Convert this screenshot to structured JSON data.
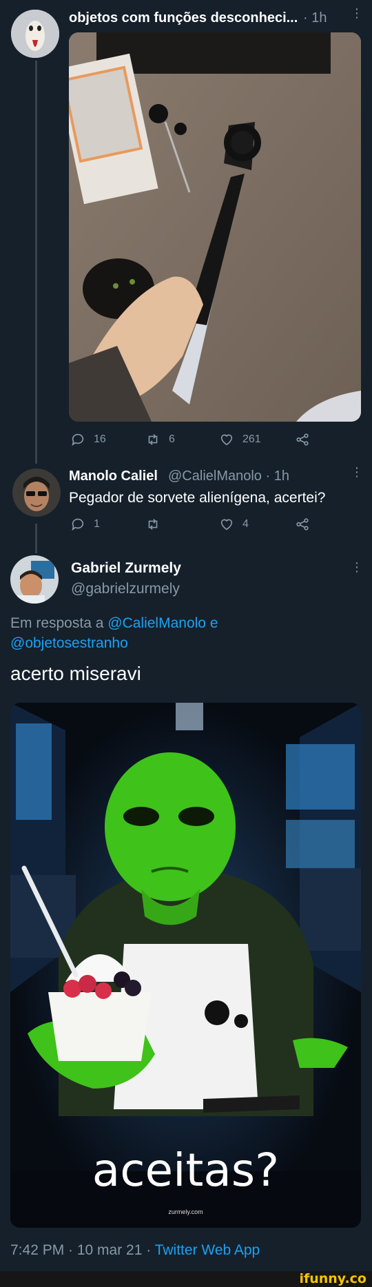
{
  "tweet1": {
    "author": "objetos com funções desconheci...",
    "time": "1h",
    "actions": {
      "reply": "16",
      "retweet": "6",
      "like": "261"
    }
  },
  "tweet2": {
    "name": "Manolo Caliel",
    "handle_time": "@CalielManolo · 1h",
    "text": "Pegador de sorvete alienígena, acertei?",
    "actions": {
      "reply": "1",
      "retweet": "",
      "like": "4"
    }
  },
  "tweet3": {
    "name": "Gabriel Zurmely",
    "handle": "@gabrielzurmely",
    "reply_prefix": "Em resposta a",
    "reply_mention1": "@CalielManolo",
    "reply_and": "e",
    "reply_mention2": "@objetosestranho",
    "text": "acerto miseravi",
    "meme_caption": "aceitas?",
    "meme_watermark": "zurmely.com",
    "footer": "7:42 PM · 10 mar 21 · ",
    "footer_app": "Twitter Web App"
  },
  "site_watermark": "ifunny.co",
  "colors": {
    "background": "#15202b",
    "muted": "#8899a6",
    "link": "#1da1f2",
    "line": "#38444d",
    "alien_green": "#3fc21a"
  },
  "icons": [
    "reply-icon",
    "retweet-icon",
    "like-icon",
    "share-icon",
    "more-icon"
  ]
}
